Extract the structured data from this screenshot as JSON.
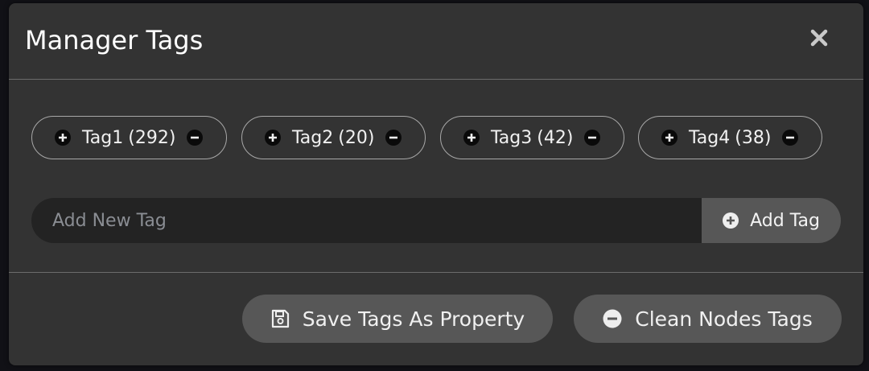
{
  "modal": {
    "title": "Manager Tags"
  },
  "tags": [
    {
      "name": "Tag1",
      "count": "(292)"
    },
    {
      "name": "Tag2",
      "count": "(20)"
    },
    {
      "name": "Tag3",
      "count": "(42)"
    },
    {
      "name": "Tag4",
      "count": "(38)"
    }
  ],
  "new_tag": {
    "placeholder": "Add New Tag",
    "value": "",
    "button_label": "Add Tag"
  },
  "footer": {
    "save_label": "Save Tags As Property",
    "clean_label": "Clean Nodes Tags"
  },
  "icons": {
    "close": "close-icon",
    "add": "plus-circle-icon",
    "remove": "minus-circle-icon",
    "save": "floppy-disk-icon"
  },
  "colors": {
    "modal_bg": "#333333",
    "button_bg": "#575757",
    "input_bg": "#232323",
    "pill_border": "#a8a8a8",
    "text": "#ffffff"
  }
}
